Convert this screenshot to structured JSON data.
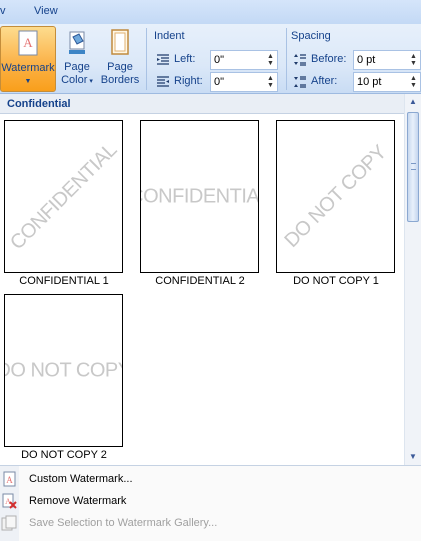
{
  "menubar": {
    "tab_partial": "v",
    "tab_view": "View"
  },
  "ribbon": {
    "watermark_label": "Watermark",
    "page_color_label_1": "Page",
    "page_color_label_2": "Color",
    "page_borders_label_1": "Page",
    "page_borders_label_2": "Borders",
    "indent": {
      "title": "Indent",
      "left_label": "Left:",
      "left_value": "0\"",
      "right_label": "Right:",
      "right_value": "0\""
    },
    "spacing": {
      "title": "Spacing",
      "before_label": "Before:",
      "before_value": "0 pt",
      "after_label": "After:",
      "after_value": "10 pt"
    }
  },
  "gallery": {
    "section_title": "Confidential",
    "items": [
      {
        "caption": "CONFIDENTIAL 1",
        "watermark_text": "CONFIDENTIAL",
        "style": "diagonal"
      },
      {
        "caption": "CONFIDENTIAL 2",
        "watermark_text": "CONFIDENTIAL",
        "style": "horizontal"
      },
      {
        "caption": "DO NOT COPY 1",
        "watermark_text": "DO NOT COPY",
        "style": "diagonal"
      },
      {
        "caption": "DO NOT COPY 2",
        "watermark_text": "DO NOT COPY",
        "style": "horizontal"
      }
    ]
  },
  "menu": {
    "custom": "Custom Watermark...",
    "remove": "Remove Watermark",
    "save": "Save Selection to Watermark Gallery..."
  },
  "colors": {
    "accent": "#15428b",
    "active_button": "#fbb34a",
    "ribbon_bg": "#dbe8f8"
  }
}
